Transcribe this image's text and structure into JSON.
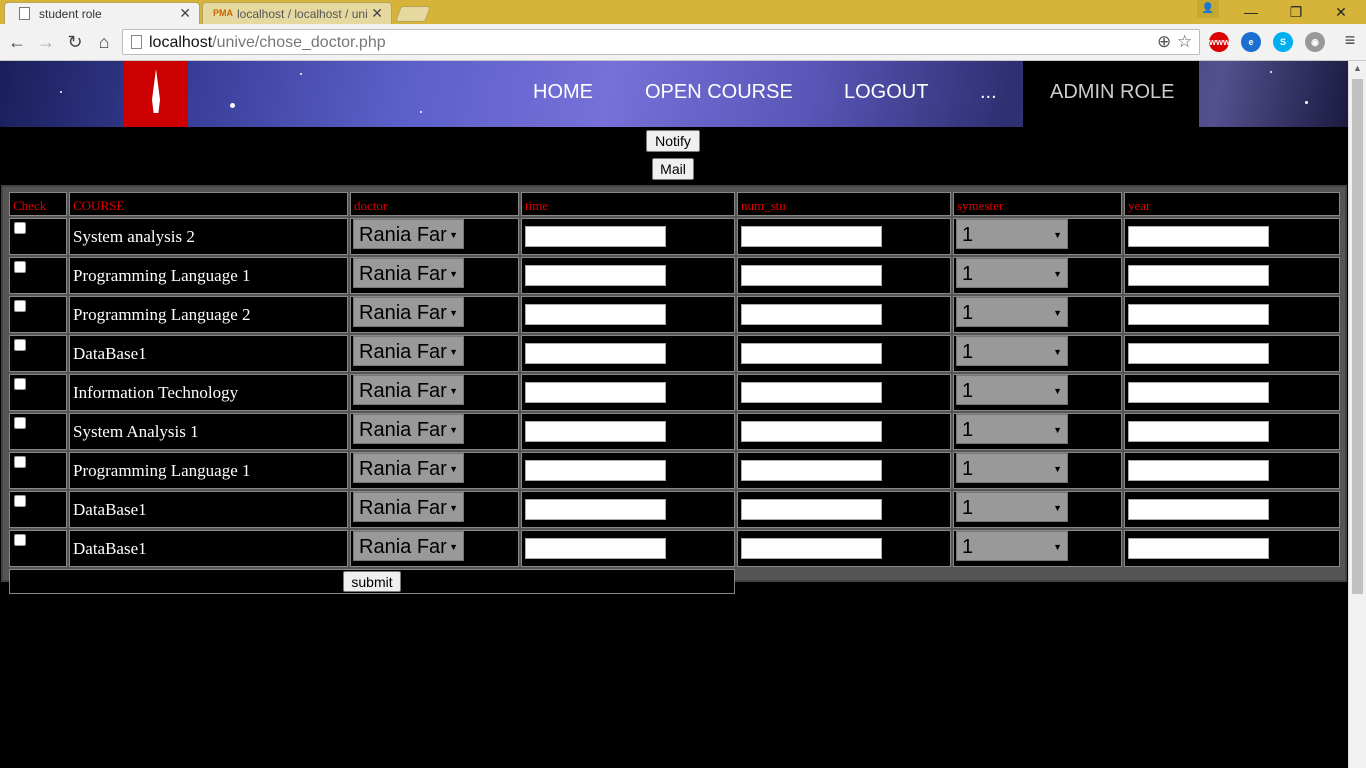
{
  "browser": {
    "tabs": [
      {
        "title": "student role",
        "active": true
      },
      {
        "title": "localhost / localhost / uni",
        "active": false
      }
    ],
    "url_host": "localhost",
    "url_path": "/unive/chose_doctor.php",
    "icons": [
      "back-icon",
      "forward-icon",
      "reload-icon",
      "home-icon",
      "zoom-icon",
      "star-icon",
      "menu-icon"
    ]
  },
  "header": {
    "nav": [
      "HOME",
      "OPEN COURSE",
      "LOGOUT",
      "..."
    ],
    "admin_label": "ADMIN ROLE",
    "logo_color": "#cc0000"
  },
  "buttons": {
    "notify": "Notify",
    "mail": "Mail",
    "submit": "submit"
  },
  "table": {
    "headers": [
      "Check",
      "COURSE",
      "doctor",
      "time",
      "num_stu",
      "symester",
      "year"
    ],
    "header_color": "#e00000",
    "rows": [
      {
        "course": "System analysis 2",
        "doctor": "Rania Far",
        "symester": "1"
      },
      {
        "course": "Programming Language 1",
        "doctor": "Rania Far",
        "symester": "1"
      },
      {
        "course": "Programming Language 2",
        "doctor": "Rania Far",
        "symester": "1"
      },
      {
        "course": "DataBase1",
        "doctor": "Rania Far",
        "symester": "1"
      },
      {
        "course": "Information Technology",
        "doctor": "Rania Far",
        "symester": "1"
      },
      {
        "course": "System Analysis 1",
        "doctor": "Rania Far",
        "symester": "1"
      },
      {
        "course": "Programming Language 1",
        "doctor": "Rania Far",
        "symester": "1"
      },
      {
        "course": "DataBase1",
        "doctor": "Rania Far",
        "symester": "1"
      },
      {
        "course": "DataBase1",
        "doctor": "Rania Far",
        "symester": "1"
      }
    ]
  }
}
